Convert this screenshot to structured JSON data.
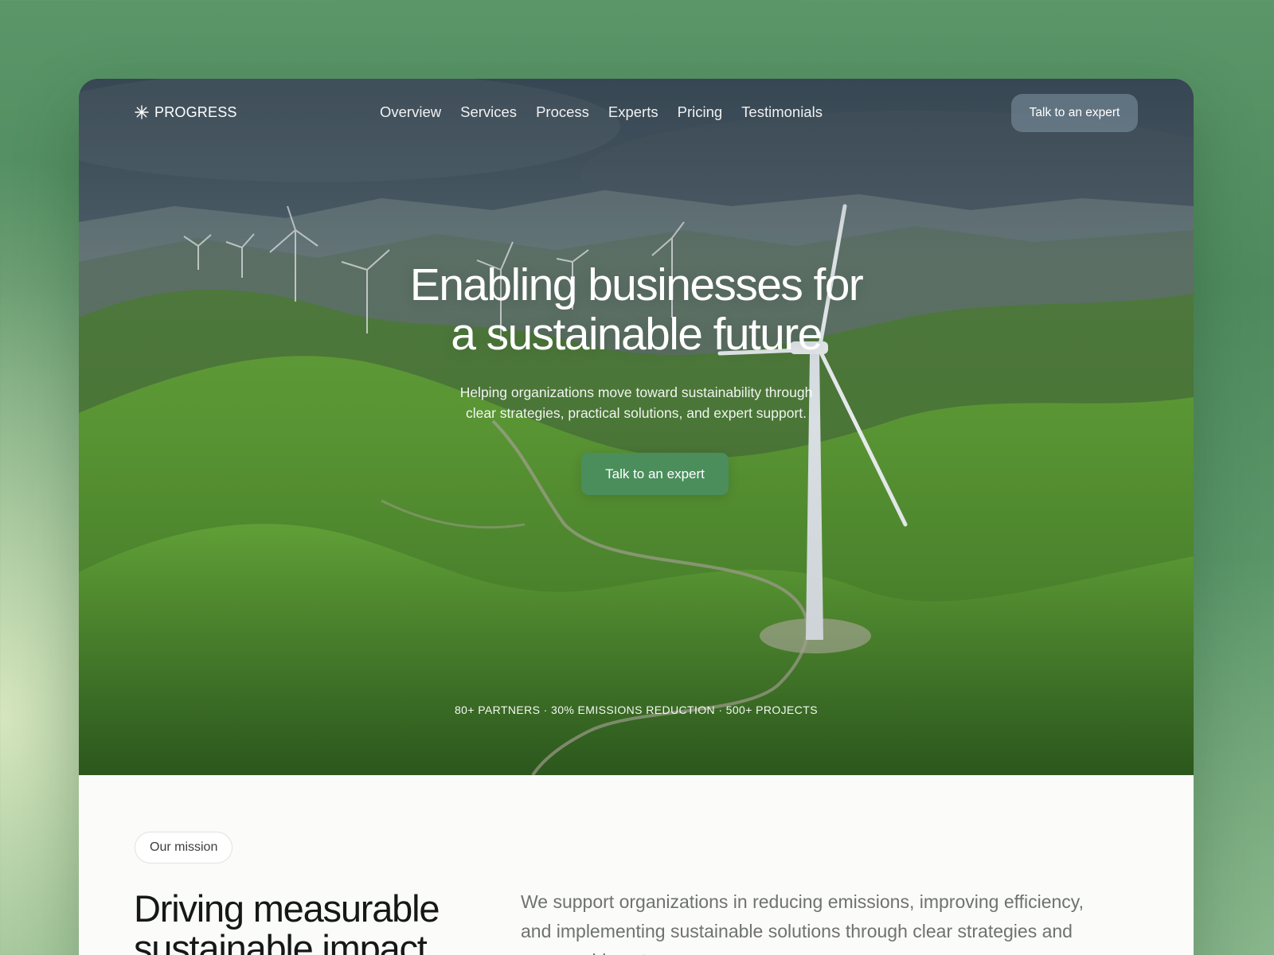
{
  "nav": {
    "brand": "PROGRESS",
    "brand_icon": "asterisk-icon",
    "links": [
      "Overview",
      "Services",
      "Process",
      "Experts",
      "Pricing",
      "Testimonials"
    ],
    "cta_label": "Talk to an expert"
  },
  "hero": {
    "title_line1": "Enabling businesses for",
    "title_line2": "a sustainable future",
    "subtitle_line1": "Helping organizations move toward sustainability through",
    "subtitle_line2": "clear strategies, practical solutions, and expert support.",
    "cta_label": "Talk to an expert",
    "stats": "80+ PARTNERS · 30% EMISSIONS REDUCTION · 500+ PROJECTS",
    "image_subject": "wind turbines on green rolling hills"
  },
  "mission": {
    "pill_label": "Our mission",
    "title_line1": "Driving measurable",
    "title_line2": "sustainable impact",
    "text": "We support organizations in reducing emissions, improving efficiency, and implementing sustainable solutions through clear strategies and measurable outcomes."
  },
  "colors": {
    "accent_green": "#4b8e5c",
    "page_background": "#5a9668",
    "card_background": "#fbfbfa",
    "heading_text": "#141816",
    "body_text": "#6e7270"
  }
}
